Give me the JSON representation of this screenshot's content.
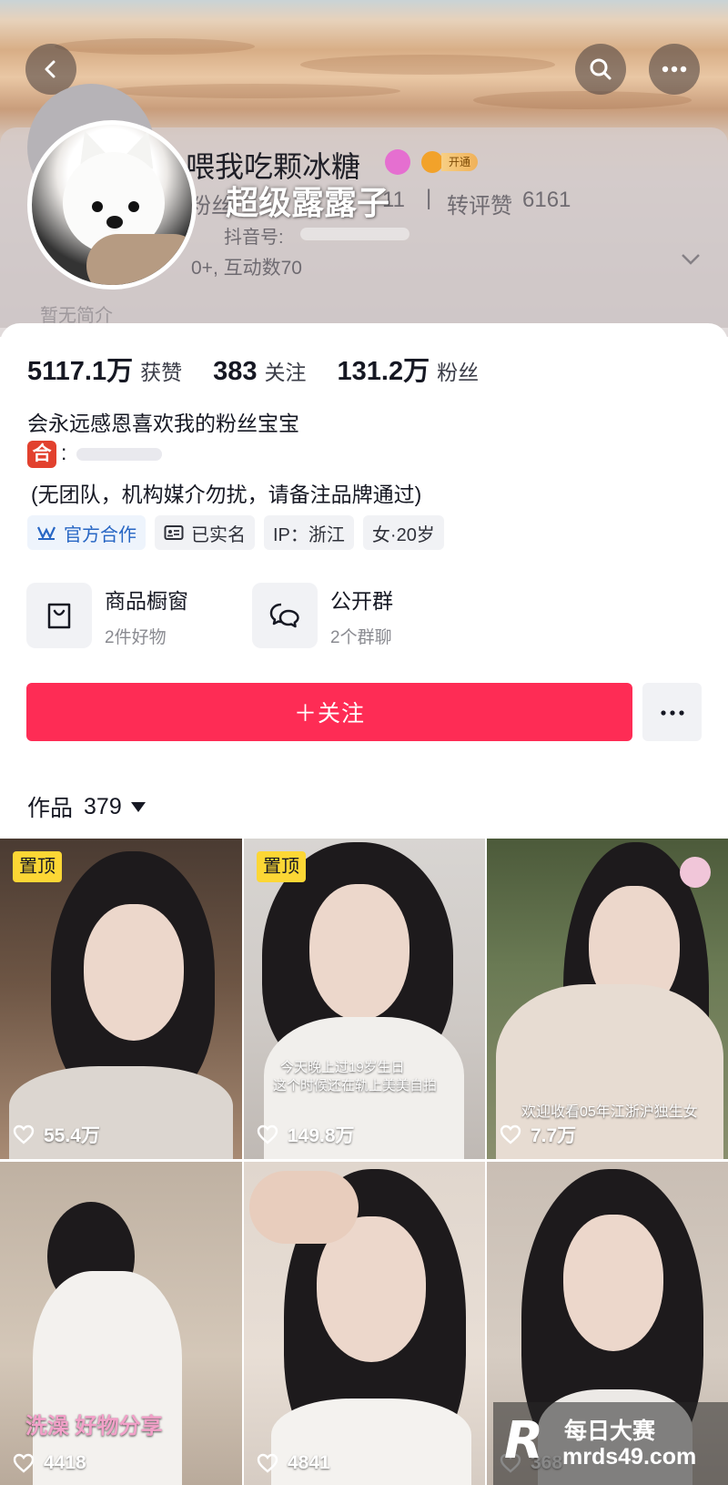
{
  "header": {
    "back_icon": "back-arrow-icon",
    "search_icon": "search-icon",
    "more_icon": "more-dots-icon"
  },
  "profile": {
    "nickname": "喂我吃颗冰糖",
    "vip_label": "开通",
    "overlay_caption": "超级露露子",
    "ghost_fans_prefix": "粉丝",
    "ghost_mid_value": "11",
    "repost_label": "转评赞",
    "repost_value": "6161",
    "douyin_id_label": "抖音号:",
    "ghost_interact": "0+, 互动数70",
    "ghost_intro": "暂无简介"
  },
  "stats": [
    {
      "value": "5117.1万",
      "label": "获赞"
    },
    {
      "value": "383",
      "label": "关注"
    },
    {
      "value": "131.2万",
      "label": "粉丝"
    }
  ],
  "bio": {
    "line1": "会永远感恩喜欢我的粉丝宝宝",
    "he_badge": "合",
    "he_colon": ":",
    "line3": "(无团队，机构媒介勿扰，请备注品牌通过)"
  },
  "tags": [
    {
      "label": "官方合作",
      "icon": "official-cooperation-icon"
    },
    {
      "label": "已实名",
      "icon": "id-card-icon"
    },
    {
      "label": "IP：浙江",
      "icon": ""
    },
    {
      "label": "女·20岁",
      "icon": ""
    }
  ],
  "entries": [
    {
      "title": "商品橱窗",
      "sub": "2件好物",
      "icon": "shopping-bag-icon"
    },
    {
      "title": "公开群",
      "sub": "2个群聊",
      "icon": "chat-bubbles-icon"
    }
  ],
  "actions": {
    "follow_label": "＋关注",
    "more_icon": "more-dots-icon"
  },
  "works": {
    "label": "作品",
    "count": "379"
  },
  "grid": [
    {
      "pinned": "置顶",
      "likes": "55.4万",
      "caption": ""
    },
    {
      "pinned": "置顶",
      "likes": "149.8万",
      "caption": "今天晚上过19岁生日",
      "caption2": "这个时候还在轨上美美自拍"
    },
    {
      "pinned": "",
      "likes": "7.7万",
      "caption": "欢迎收看05年江浙沪独生女"
    },
    {
      "pinned": "",
      "likes": "4418",
      "caption": "洗澡 好物分享"
    },
    {
      "pinned": "",
      "likes": "4841",
      "caption": ""
    },
    {
      "pinned": "",
      "likes": "368",
      "caption": ""
    }
  ],
  "watermark": {
    "logo": "R",
    "title": "每日大赛",
    "url": "mrds49.com"
  },
  "colors": {
    "follow_button": "#fe2c55",
    "pin_badge": "#fcd735",
    "official_tag": "#2766c4",
    "he_badge": "#e2412e"
  }
}
